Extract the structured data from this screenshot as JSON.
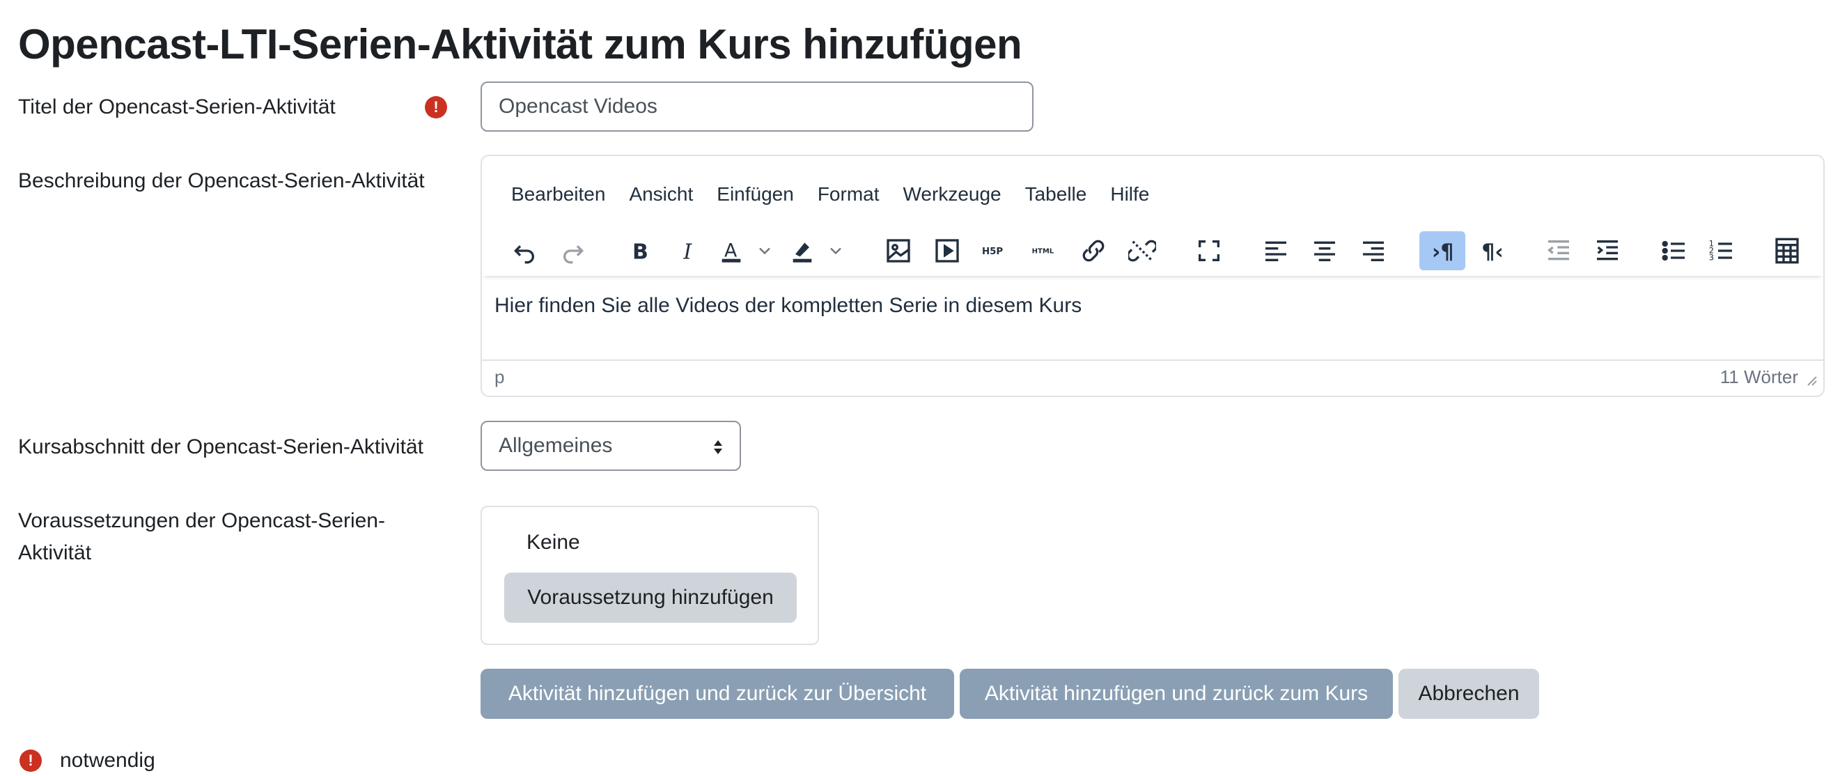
{
  "page": {
    "title": "Opencast-LTI-Serien-Aktivität zum Kurs hinzufügen"
  },
  "fields": {
    "title": {
      "label": "Titel der Opencast-Serien-Aktivität",
      "value": "Opencast Videos",
      "required": true
    },
    "description": {
      "label": "Beschreibung der Opencast-Serien-Aktivität",
      "content": "Hier finden Sie alle Videos der kompletten Serie in diesem Kurs",
      "status_path": "p",
      "word_count": "11 Wörter"
    },
    "section": {
      "label": "Kursabschnitt der Opencast-Serien-Aktivität",
      "selected": "Allgemeines"
    },
    "restrictions": {
      "label": "Voraussetzungen der Opencast-Serien-Aktivität",
      "none_text": "Keine",
      "add_button": "Voraussetzung hinzufügen"
    }
  },
  "editor": {
    "menu": [
      "Bearbeiten",
      "Ansicht",
      "Einfügen",
      "Format",
      "Werkzeuge",
      "Tabelle",
      "Hilfe"
    ],
    "toolbar_icons": [
      "undo-icon",
      "redo-icon",
      "bold-icon",
      "italic-icon",
      "text-color-icon",
      "highlight-color-icon",
      "image-icon",
      "media-icon",
      "h5p-icon",
      "html-icon",
      "link-icon",
      "unlink-icon",
      "fullscreen-icon",
      "align-left-icon",
      "align-center-icon",
      "align-right-icon",
      "ltr-icon",
      "rtl-icon",
      "outdent-icon",
      "indent-icon",
      "bullet-list-icon",
      "numbered-list-icon",
      "calculator-icon"
    ],
    "h5p_text": "H5P",
    "html_text": "HTML"
  },
  "buttons": {
    "save_return_overview": "Aktivität hinzufügen und zurück zur Übersicht",
    "save_return_course": "Aktivität hinzufügen und zurück zum Kurs",
    "cancel": "Abbrechen"
  },
  "footer": {
    "required_note": "notwendig"
  },
  "colors": {
    "required": "#ca3120",
    "primary_button": "#8a9fb3",
    "secondary_button": "#ced4da",
    "active_toolbar": "#a6c8f5"
  }
}
